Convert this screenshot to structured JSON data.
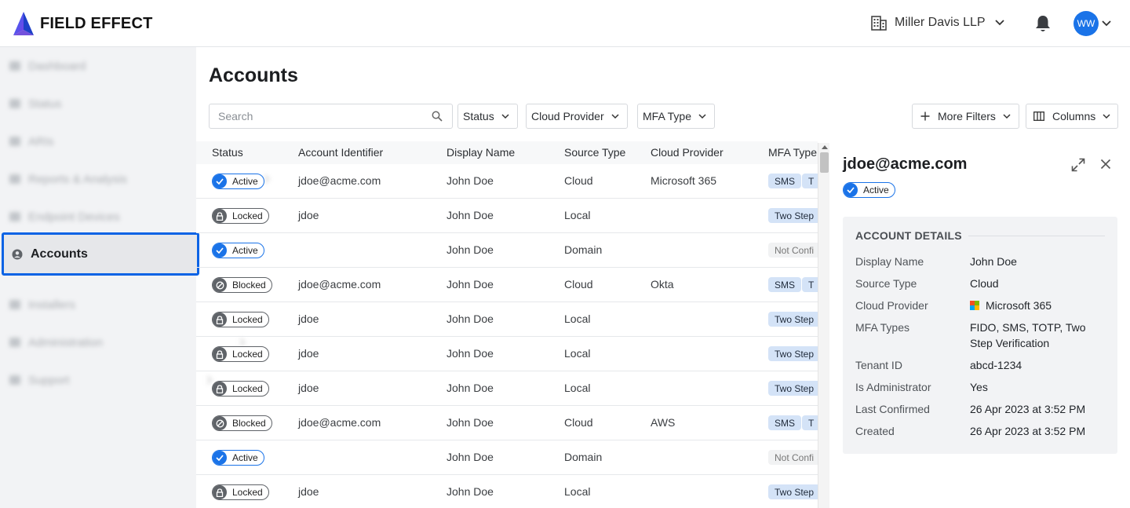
{
  "header": {
    "brand": "FIELD EFFECT",
    "org_name": "Miller Davis LLP",
    "user_initials": "WW"
  },
  "sidebar": {
    "items": [
      {
        "label": "Dashboard",
        "icon": "grid-icon"
      },
      {
        "label": "Status",
        "icon": "pulse-icon"
      },
      {
        "label": "ARIs",
        "icon": "alert-icon"
      },
      {
        "label": "Reports & Analysis",
        "icon": "report-icon",
        "has_children": true
      },
      {
        "label": "Endpoint Devices",
        "icon": "device-icon"
      },
      {
        "label": "Accounts",
        "icon": "user-circle-icon",
        "active": true
      },
      {
        "label": "Installers",
        "icon": "download-icon"
      },
      {
        "label": "Administration",
        "icon": "admin-icon",
        "has_children": true
      },
      {
        "label": "Support",
        "icon": "help-icon",
        "has_children": true
      }
    ]
  },
  "main": {
    "title": "Accounts",
    "search_placeholder": "Search",
    "filters": {
      "status": "Status",
      "cloud_provider": "Cloud Provider",
      "mfa_type": "MFA Type",
      "more_filters": "More Filters",
      "columns": "Columns"
    },
    "table": {
      "headers": {
        "status": "Status",
        "account_identifier": "Account Identifier",
        "display_name": "Display Name",
        "source_type": "Source Type",
        "cloud_provider": "Cloud Provider",
        "mfa_type": "MFA Type"
      },
      "rows": [
        {
          "status": "Active",
          "account_identifier": "jdoe@acme.com",
          "display_name": "John Doe",
          "source_type": "Cloud",
          "cloud_provider": "Microsoft 365",
          "mfa": [
            "SMS",
            "T"
          ]
        },
        {
          "status": "Locked",
          "account_identifier": "jdoe",
          "display_name": "John Doe",
          "source_type": "Local",
          "cloud_provider": "",
          "mfa": [
            "Two Step"
          ]
        },
        {
          "status": "Active",
          "account_identifier": "",
          "display_name": "John Doe",
          "source_type": "Domain",
          "cloud_provider": "",
          "mfa": [
            "Not Confi"
          ],
          "mfa_muted": true
        },
        {
          "status": "Blocked",
          "account_identifier": "jdoe@acme.com",
          "display_name": "John Doe",
          "source_type": "Cloud",
          "cloud_provider": "Okta",
          "mfa": [
            "SMS",
            "T"
          ]
        },
        {
          "status": "Locked",
          "account_identifier": "jdoe",
          "display_name": "John Doe",
          "source_type": "Local",
          "cloud_provider": "",
          "mfa": [
            "Two Step"
          ]
        },
        {
          "status": "Locked",
          "account_identifier": "jdoe",
          "display_name": "John Doe",
          "source_type": "Local",
          "cloud_provider": "",
          "mfa": [
            "Two Step"
          ]
        },
        {
          "status": "Locked",
          "account_identifier": "jdoe",
          "display_name": "John Doe",
          "source_type": "Local",
          "cloud_provider": "",
          "mfa": [
            "Two Step"
          ]
        },
        {
          "status": "Blocked",
          "account_identifier": "jdoe@acme.com",
          "display_name": "John Doe",
          "source_type": "Cloud",
          "cloud_provider": "AWS",
          "mfa": [
            "SMS",
            "T"
          ]
        },
        {
          "status": "Active",
          "account_identifier": "",
          "display_name": "John Doe",
          "source_type": "Domain",
          "cloud_provider": "",
          "mfa": [
            "Not Confi"
          ],
          "mfa_muted": true
        },
        {
          "status": "Locked",
          "account_identifier": "jdoe",
          "display_name": "John Doe",
          "source_type": "Local",
          "cloud_provider": "",
          "mfa": [
            "Two Step"
          ]
        }
      ]
    }
  },
  "detail": {
    "title": "jdoe@acme.com",
    "status": "Active",
    "section_title": "ACCOUNT DETAILS",
    "fields": [
      {
        "label": "Display Name",
        "value": "John Doe"
      },
      {
        "label": "Source Type",
        "value": "Cloud"
      },
      {
        "label": "Cloud Provider",
        "value": "Microsoft 365",
        "logo": true
      },
      {
        "label": "MFA Types",
        "value": "FIDO, SMS, TOTP, Two Step Verification"
      },
      {
        "label": "Tenant ID",
        "value": "abcd-1234"
      },
      {
        "label": "Is Administrator",
        "value": "Yes"
      },
      {
        "label": "Last Confirmed",
        "value": "26 Apr 2023 at 3:52 PM"
      },
      {
        "label": "Created",
        "value": "26 Apr 2023 at 3:52 PM"
      }
    ]
  },
  "colors": {
    "accent": "#1a73e8",
    "active_outline": "#0b63e5",
    "chip_bg": "#d4e3f7",
    "sidebar_bg": "#f2f3f5"
  }
}
